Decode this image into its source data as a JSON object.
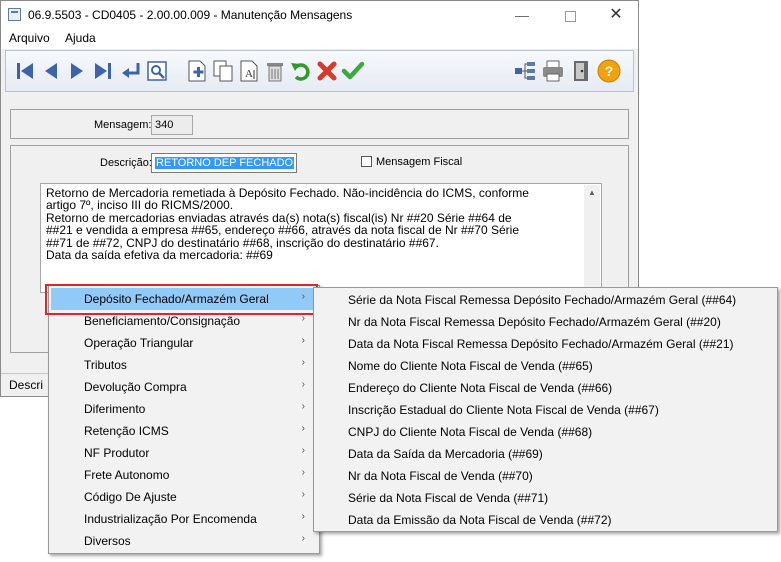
{
  "window": {
    "title": "06.9.5503 - CD0405 - 2.00.00.009 - Manutenção Mensagens",
    "controls": {
      "minimize": "—",
      "close": "✕"
    }
  },
  "menubar": {
    "items": [
      "Arquivo",
      "Ajuda"
    ]
  },
  "toolbar": {
    "buttons": [
      "first-icon",
      "previous-icon",
      "next-icon",
      "last-icon",
      "goto-icon",
      "search-icon",
      "add-icon",
      "copy-icon",
      "edit-icon",
      "delete-icon",
      "undo-icon",
      "cancel-icon",
      "save-icon",
      "tree-icon",
      "print-icon",
      "exit-icon",
      "help-icon"
    ],
    "help_label": "?"
  },
  "form": {
    "mensagem_label": "Mensagem:",
    "mensagem_value": "340",
    "descricao_label": "Descrição:",
    "descricao_value": "RETORNO DEP FECHADO",
    "mensagem_fiscal_label": "Mensagem Fiscal",
    "mensagem_fiscal_checked": false
  },
  "message_text": [
    "Retorno de Mercadoria remetiada à Depósito Fechado. Não-incidência do ICMS, conforme",
    "artigo 7º, inciso III do RICMS/2000.",
    "Retorno de mercadorias enviadas através da(s) nota(s) fiscal(is) Nr ##20 Série ##64 de",
    "##21 e vendida a empresa ##65, endereço ##66, através da nota fiscal de Nr ##70 Série",
    "##71 de ##72, CNPJ do destinatário ##68, inscrição do destinatário ##67.",
    "Data da saída efetiva da mercadoria: ##69"
  ],
  "statusbar": {
    "text": "Descri"
  },
  "context_menu": {
    "items": [
      "Depósito Fechado/Armazém Geral",
      "Beneficiamento/Consignação",
      "Operação Triangular",
      "Tributos",
      "Devolução Compra",
      "Diferimento",
      "Retenção ICMS",
      "NF Produtor",
      "Frete Autonomo",
      "Código De Ajuste",
      "Industrialização Por Encomenda",
      "Diversos"
    ],
    "highlighted": "Depósito Fechado/Armazém Geral",
    "arrow": "›"
  },
  "submenu": {
    "items": [
      "Série da Nota Fiscal Remessa Depósito Fechado/Armazém Geral (##64)",
      "Nr da Nota Fiscal Remessa Depósito Fechado/Armazém Geral (##20)",
      "Data da Nota Fiscal Remessa Depósito Fechado/Armazém Geral (##21)",
      "Nome do Cliente Nota Fiscal de Venda (##65)",
      "Endereço do Cliente Nota Fiscal de Venda (##66)",
      "Inscrição Estadual do Cliente Nota Fiscal de Venda (##67)",
      "CNPJ do Cliente Nota Fiscal de Venda (##68)",
      "Data da Saída da Mercadoria (##69)",
      "Nr da Nota Fiscal de Venda (##70)",
      "Série da Nota Fiscal de Venda (##71)",
      "Data da Emissão da Nota Fiscal de Venda (##72)"
    ]
  },
  "colors": {
    "highlight": "#91c9f7",
    "callout": "#e0262a",
    "selection": "#3399ff",
    "toolbar_blue": "#3f63a8",
    "undo_green": "#2e9b2e",
    "cancel_red": "#d63a2a",
    "help_orange": "#f2a20c"
  }
}
